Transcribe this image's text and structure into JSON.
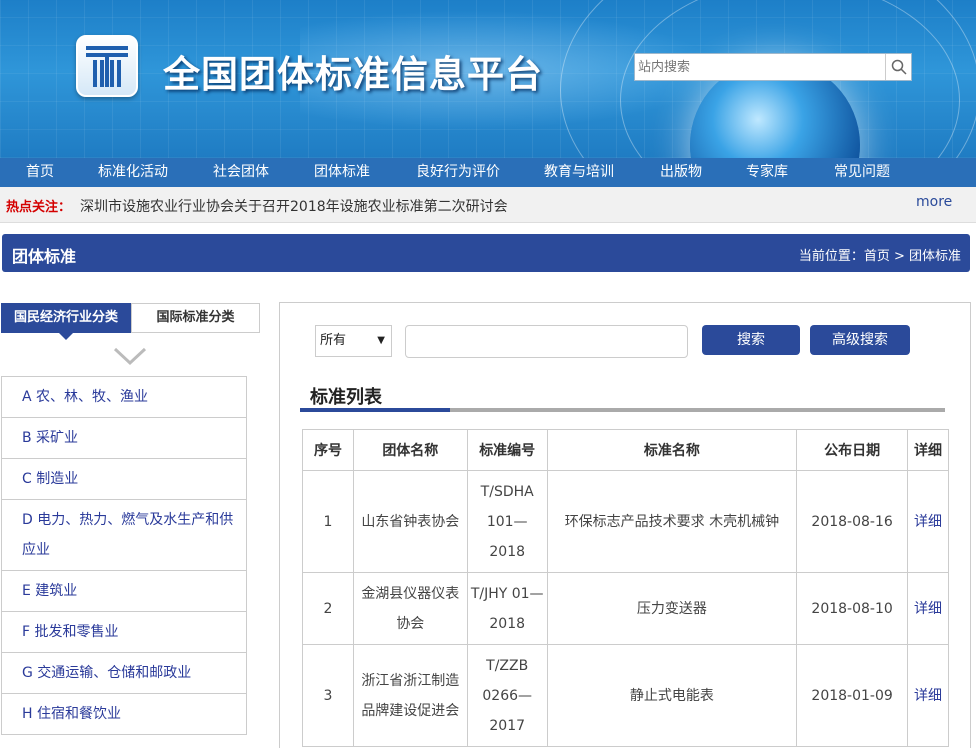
{
  "header": {
    "site_title": "全国团体标准信息平台",
    "search_placeholder": "站内搜索",
    "search_icon": "search-icon",
    "logo": "logo-t-icon"
  },
  "nav": {
    "items": [
      {
        "label": "首页"
      },
      {
        "label": "标准化活动"
      },
      {
        "label": "社会团体"
      },
      {
        "label": "团体标准"
      },
      {
        "label": "良好行为评价"
      },
      {
        "label": "教育与培训"
      },
      {
        "label": "出版物"
      },
      {
        "label": "专家库"
      },
      {
        "label": "常见问题"
      }
    ]
  },
  "hotbar": {
    "label": "热点关注：",
    "text": "深圳市设施农业行业协会关于召开2018年设施农业标准第二次研讨会",
    "more": "more"
  },
  "section": {
    "title": "团体标准",
    "breadcrumb": "当前位置：首页 > 团体标准"
  },
  "sidebar": {
    "tabs": [
      {
        "label": "国民经济行业分类"
      },
      {
        "label": "国际标准分类"
      }
    ],
    "categories": [
      {
        "label": "A 农、林、牧、渔业"
      },
      {
        "label": "B 采矿业"
      },
      {
        "label": "C 制造业"
      },
      {
        "label": "D 电力、热力、燃气及水生产和供应业"
      },
      {
        "label": "E 建筑业"
      },
      {
        "label": "F 批发和零售业"
      },
      {
        "label": "G 交通运输、仓储和邮政业"
      },
      {
        "label": "H 住宿和餐饮业"
      }
    ]
  },
  "search_panel": {
    "scope_selected": "所有",
    "search_button": "搜索",
    "advanced_button": "高级搜索",
    "list_title": "标准列表"
  },
  "table": {
    "headers": [
      "序号",
      "团体名称",
      "标准编号",
      "标准名称",
      "公布日期",
      "详细"
    ],
    "rows": [
      {
        "no": "1",
        "org": "山东省钟表协会",
        "code": "T/SDHA 101—2018",
        "name": "环保标志产品技术要求 木壳机械钟",
        "date": "2018-08-16",
        "detail": "详细"
      },
      {
        "no": "2",
        "org": "金湖县仪器仪表协会",
        "code": "T/JHY 01—2018",
        "name": "压力变送器",
        "date": "2018-08-10",
        "detail": "详细"
      },
      {
        "no": "3",
        "org": "浙江省浙江制造品牌建设促进会",
        "code": "T/ZZB 0266—2017",
        "name": "静止式电能表",
        "date": "2018-01-09",
        "detail": "详细"
      }
    ]
  },
  "colors": {
    "primary": "#2b4a9a",
    "nav": "#2a6fb8",
    "hot": "#d40000"
  }
}
